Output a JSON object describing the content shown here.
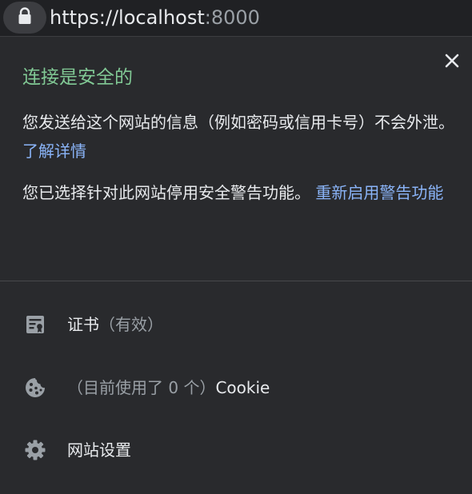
{
  "address_bar": {
    "icon": "lock-icon",
    "url_host": "https://localhost",
    "url_port": ":8000"
  },
  "popup": {
    "close_icon": "close-icon",
    "title": "连接是安全的",
    "info_text": "您发送给这个网站的信息（例如密码或信用卡号）不会外泄。",
    "learn_more_link": "了解详情",
    "warning_text": "您已选择针对此网站停用安全警告功能。",
    "reenable_link": "重新启用警告功能",
    "items": [
      {
        "icon": "certificate-icon",
        "label": "证书",
        "sub": "（有效）"
      },
      {
        "icon": "cookie-icon",
        "label_muted": "（目前使用了 0 个）",
        "label": "Cookie"
      },
      {
        "icon": "gear-icon",
        "label": "网站设置"
      }
    ]
  },
  "colors": {
    "background": "#292a2d",
    "secure_green": "#81c995",
    "link_blue": "#8ab4f8",
    "text": "#e8eaed",
    "muted": "#9aa0a6"
  }
}
